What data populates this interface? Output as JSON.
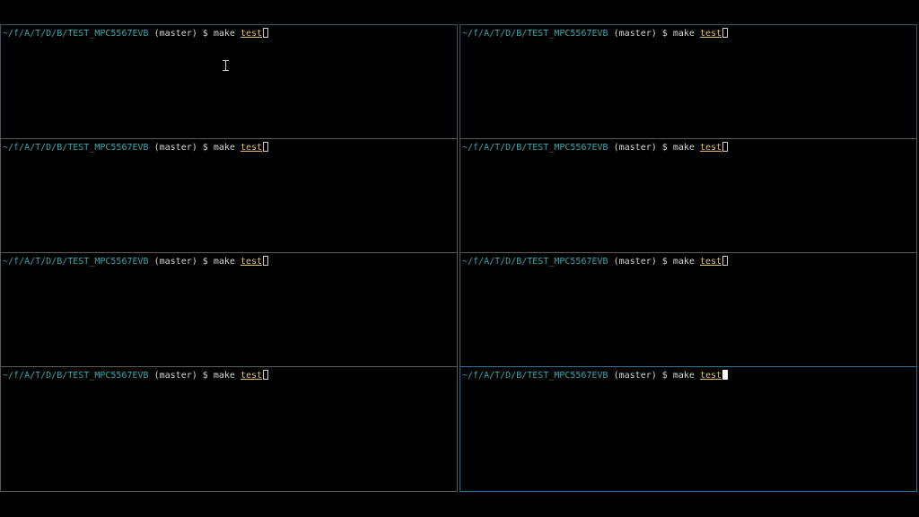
{
  "colors": {
    "background": "#000000",
    "pane_border": "#5a5a5a",
    "active_pane_border": "#2f6f98",
    "cwd": "#38a8b0",
    "argument": "#e3c06b",
    "text": "#d6d6d6"
  },
  "panes": [
    {
      "cwd": "~/f/A/T/D/B/TEST_MPC5567EVB",
      "branch": "(master)",
      "prompt": "$",
      "command": "make",
      "argument": "test",
      "active": false
    },
    {
      "cwd": "~/f/A/T/D/B/TEST_MPC5567EVB",
      "branch": "(master)",
      "prompt": "$",
      "command": "make",
      "argument": "test",
      "active": false
    },
    {
      "cwd": "~/f/A/T/D/B/TEST_MPC5567EVB",
      "branch": "(master)",
      "prompt": "$",
      "command": "make",
      "argument": "test",
      "active": false
    },
    {
      "cwd": "~/f/A/T/D/B/TEST_MPC5567EVB",
      "branch": "(master)",
      "prompt": "$",
      "command": "make",
      "argument": "test",
      "active": false
    },
    {
      "cwd": "~/f/A/T/D/B/TEST_MPC5567EVB",
      "branch": "(master)",
      "prompt": "$",
      "command": "make",
      "argument": "test",
      "active": false
    },
    {
      "cwd": "~/f/A/T/D/B/TEST_MPC5567EVB",
      "branch": "(master)",
      "prompt": "$",
      "command": "make",
      "argument": "test",
      "active": false
    },
    {
      "cwd": "~/f/A/T/D/B/TEST_MPC5567EVB",
      "branch": "(master)",
      "prompt": "$",
      "command": "make",
      "argument": "test",
      "active": false
    },
    {
      "cwd": "~/f/A/T/D/B/TEST_MPC5567EVB",
      "branch": "(master)",
      "prompt": "$",
      "command": "make",
      "argument": "test",
      "active": true
    }
  ],
  "mouse_cursor": "ibeam-cursor-icon"
}
